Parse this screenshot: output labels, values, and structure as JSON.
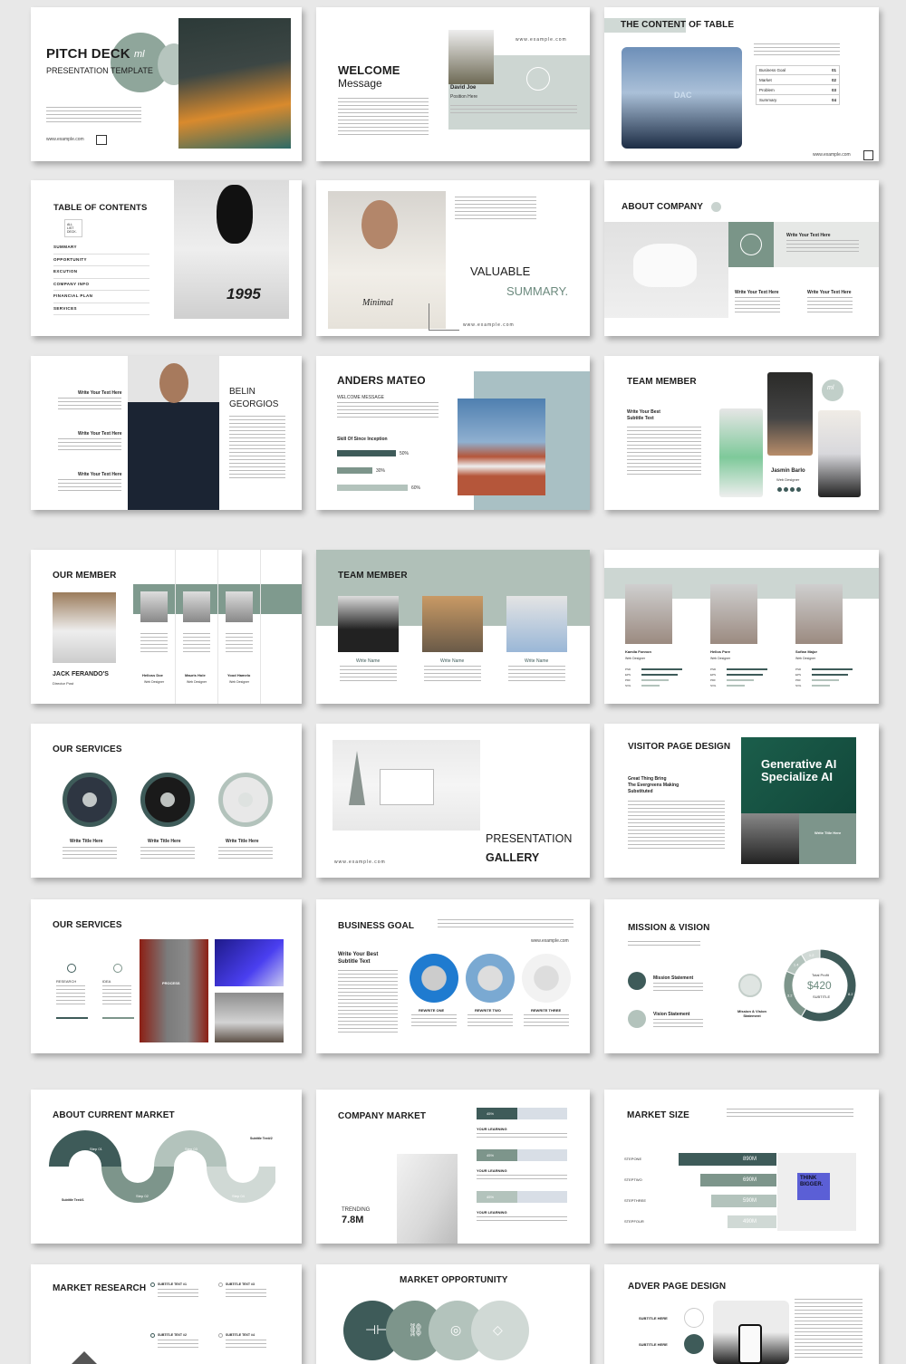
{
  "colors": {
    "dark": "#3e5b59",
    "mid": "#7d958b",
    "light": "#b3c3bc",
    "pale": "#d0d9d5",
    "background": "#e8e8e8"
  },
  "slides": {
    "pitch": {
      "title": "PITCH DECK",
      "logo": "ml",
      "subtitle": "PRESENTATION TEMPLATE",
      "url": "www.example.com"
    },
    "welcome": {
      "title": "WELCOME",
      "subtitle": "Message",
      "name": "David Joe",
      "position": "Position Here",
      "url": "www.example.com"
    },
    "content_table": {
      "title_a": "THE CONTENT",
      "title_b": " OF TABLE",
      "image_label": "DAC",
      "rows": [
        {
          "label": "Business Goal",
          "num": "01"
        },
        {
          "label": "Market",
          "num": "02"
        },
        {
          "label": "Problem",
          "num": "03"
        },
        {
          "label": "Summary",
          "num": "04"
        }
      ],
      "url": "www.example.com"
    },
    "toc": {
      "title": "TABLE OF CONTENTS",
      "box": "ALL LIST DECK.",
      "items": [
        "SUMMARY",
        "OPPORTUNITY",
        "EXCUTION",
        "COMPANY INFO",
        "FINANCIAL PLAN",
        "SERVICES"
      ],
      "shirt_text": "1995"
    },
    "valuable": {
      "line1": "VALUABLE",
      "line2": "SUMMARY.",
      "shirt_text": "Minimal",
      "url": "www.example.com"
    },
    "about": {
      "title": "ABOUT COMPANY",
      "heading": "Write Your Text Here"
    },
    "belin": {
      "name1": "BELIN",
      "name2": "GEORGIOS",
      "heading": "Write Your Text Here"
    },
    "anders": {
      "title": "ANDERS MATEO",
      "welcome": "WELCOME MESSAGE",
      "skill": "Skill Of Since Inception",
      "skills": [
        {
          "value": 50,
          "label": "50%",
          "color": "#3e5b59"
        },
        {
          "value": 30,
          "label": "30%",
          "color": "#7d958b"
        },
        {
          "value": 60,
          "label": "60%",
          "color": "#b3c3bc"
        }
      ]
    },
    "team1": {
      "title": "TEAM MEMBER",
      "subtitle1": "Write Your Best",
      "subtitle2": "Subtitle Text",
      "name": "Jasmin Barlo",
      "role": "Web Designer",
      "logo": "ml"
    },
    "our_member": {
      "title": "OUR MEMBER",
      "lead_name": "JACK FERANDO'S",
      "lead_role": "Director Post",
      "members": [
        {
          "name": "Helloss Doe",
          "role": "Web Designer"
        },
        {
          "name": "Mauris Hole",
          "role": "Web Designer"
        },
        {
          "name": "Yood Hamelo",
          "role": "Web Designer"
        }
      ]
    },
    "team2": {
      "title": "TEAM MEMBER",
      "names": [
        "Write Name",
        "Write Name",
        "Write Name"
      ]
    },
    "team3": {
      "members": [
        {
          "name": "Kamila Fonnon",
          "role": "Web Designer"
        },
        {
          "name": "Hellos Pore",
          "role": "Web Designer"
        },
        {
          "name": "Sofian Major",
          "role": "Web Designer"
        }
      ],
      "skills": [
        "PSD",
        "EPS",
        "PDF",
        "SVG"
      ],
      "skill_levels": [
        90,
        80,
        60,
        40
      ]
    },
    "services1": {
      "title": "OUR SERVICES",
      "items": [
        "Write Title Here",
        "Write Title Here",
        "Write Title Here"
      ]
    },
    "gallery": {
      "line1": "PRESENTATION",
      "line2": "GALLERY",
      "url": "www.example.com"
    },
    "visitor": {
      "title": "VISITOR PAGE DESIGN",
      "sub1": "Great Thing Bring",
      "sub2": "The Evergreens Making",
      "sub3": "Substituted",
      "banner1": "Generative AI",
      "banner2": "Specialize AI",
      "panel": "Write Title Here"
    },
    "services2": {
      "title": "OUR SERVICES",
      "items": [
        "RESEARCH",
        "IDEA",
        "PROCESS"
      ]
    },
    "business": {
      "title": "BUSINESS GOAL",
      "subtitle1": "Write Your Best",
      "subtitle2": "Subtitle Text",
      "url": "www.example.com",
      "items": [
        "REWRITE ONE",
        "REWRITE TWO",
        "REWRITE THREE"
      ]
    },
    "mission": {
      "title": "MISSION & VISION",
      "mission": "Mission Statement",
      "vision": "Vision Statement",
      "combined": "Mission & Vision Statement",
      "donut_label": "Total Profit",
      "donut_value": "$420",
      "donut_sub": "SUBTITLE",
      "segments": [
        {
          "label": "8.2",
          "value": 8.2,
          "color": "#3e5b59"
        },
        {
          "label": "3.2",
          "value": 3.2,
          "color": "#7d958b"
        },
        {
          "label": "1.4",
          "value": 1.4,
          "color": "#b3c3bc"
        },
        {
          "label": "1.2",
          "value": 1.2,
          "color": "#d0d9d5"
        }
      ]
    },
    "current_market": {
      "title": "ABOUT CURRENT MARKET",
      "steps": [
        "Step 01",
        "Step 02",
        "Step 03",
        "Step 04"
      ],
      "sub1": "Subtitle Text#1",
      "sub2": "Subtitle Text#2"
    },
    "company_market": {
      "title": "COMPANY  MARKET",
      "bars": [
        {
          "label": "45%",
          "fill": 0.45
        },
        {
          "label": "45%",
          "fill": 0.45
        },
        {
          "label": "45%",
          "fill": 0.45
        }
      ],
      "heading": "YOUR LEARNING",
      "trending": "TRENDING",
      "trending_value": "7.8M"
    },
    "market_size": {
      "title": "MARKET SIZE",
      "rows": [
        {
          "label": "STEPONE",
          "value": 890,
          "text": "890M"
        },
        {
          "label": "STEPTWO",
          "value": 690,
          "text": "690M"
        },
        {
          "label": "STEPTHREE",
          "value": 590,
          "text": "590M"
        },
        {
          "label": "STEPFOUR",
          "value": 490,
          "text": "490M"
        }
      ],
      "image_text": "THINK BIGGER."
    },
    "research": {
      "title": "MARKET RESEARCH",
      "items": [
        "SUBTITLE TEXT #1",
        "SUBTITLE TEXT #3",
        "SUBTITLE TEXT #2",
        "SUBTITLE TEXT #4"
      ]
    },
    "opportunity": {
      "title": "MARKET OPPORTUNITY",
      "icons": [
        "dumbbell-icon",
        "link-icon",
        "target-icon",
        "warning-diamond-icon"
      ]
    },
    "adver": {
      "title": "ADVER PAGE DESIGN",
      "sub": "SUBTITLE HERE"
    }
  }
}
